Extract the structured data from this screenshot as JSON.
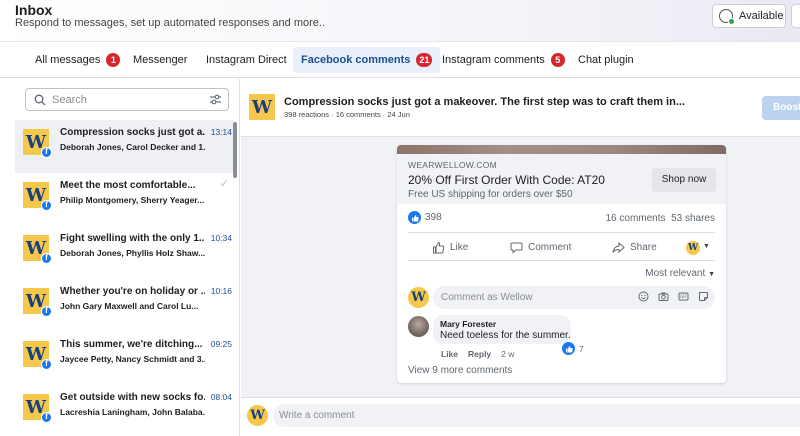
{
  "header": {
    "title": "Inbox",
    "subtitle": "Respond to messages, set up automated responses and more..",
    "status_label": "Available"
  },
  "tabs": [
    {
      "label": "All messages",
      "badge": "1"
    },
    {
      "label": "Messenger",
      "badge": ""
    },
    {
      "label": "Instagram Direct",
      "badge": ""
    },
    {
      "label": "Facebook comments",
      "badge": "21"
    },
    {
      "label": "Instagram comments",
      "badge": "5"
    },
    {
      "label": "Chat plugin",
      "badge": ""
    }
  ],
  "search": {
    "placeholder": "Search"
  },
  "conversations": [
    {
      "subject": "Compression socks just got a...",
      "names": "Deborah Jones, Carol Decker and 1...",
      "time": "13:14"
    },
    {
      "subject": "Meet the most comfortable...",
      "names": "Philip Montgomery, Sherry Yeager...",
      "time": ""
    },
    {
      "subject": "Fight swelling with the only 1...",
      "names": "Deborah Jones, Phyllis Holz Shaw...",
      "time": "10:34"
    },
    {
      "subject": "Whether you're on holiday or ...",
      "names": "John Gary Maxwell and Carol Lu...",
      "time": "10:16"
    },
    {
      "subject": "This summer, we're ditching...",
      "names": "Jaycee Petty, Nancy Schmidt and 3...",
      "time": "09:25"
    },
    {
      "subject": "Get outside with new socks fo...",
      "names": "Lacreshia Laningham, John Balaba...",
      "time": "08:04"
    }
  ],
  "brand": {
    "logo_letter": "W",
    "fb_letter": "f",
    "accent": "#1877f2",
    "logo_bg": "#f5c84c"
  },
  "post": {
    "title": "Compression socks just got a makeover. The first step was to craft them in...",
    "meta": "398 reactions · 16 comments · 24 Jun",
    "boost_label": "Boost"
  },
  "ad": {
    "domain": "WEARWELLOW.COM",
    "headline": "20% Off First Order With Code: AT20",
    "description": "Free US shipping for orders over $50",
    "cta": "Shop now"
  },
  "stats": {
    "reactions": "398",
    "comments": "16 comments",
    "shares": "53 shares"
  },
  "actions": {
    "like": "Like",
    "comment": "Comment",
    "share": "Share"
  },
  "sort_label": "Most relevant",
  "comment_placeholder": "Comment as Wellow",
  "comment": {
    "author": "Mary Forester",
    "text": "Need toeless for the summer.",
    "like_label": "Like",
    "reply_label": "Reply",
    "age": "2 w",
    "reaction_count": "7"
  },
  "view_more": "View 9 more comments",
  "composer_placeholder": "Write a comment"
}
